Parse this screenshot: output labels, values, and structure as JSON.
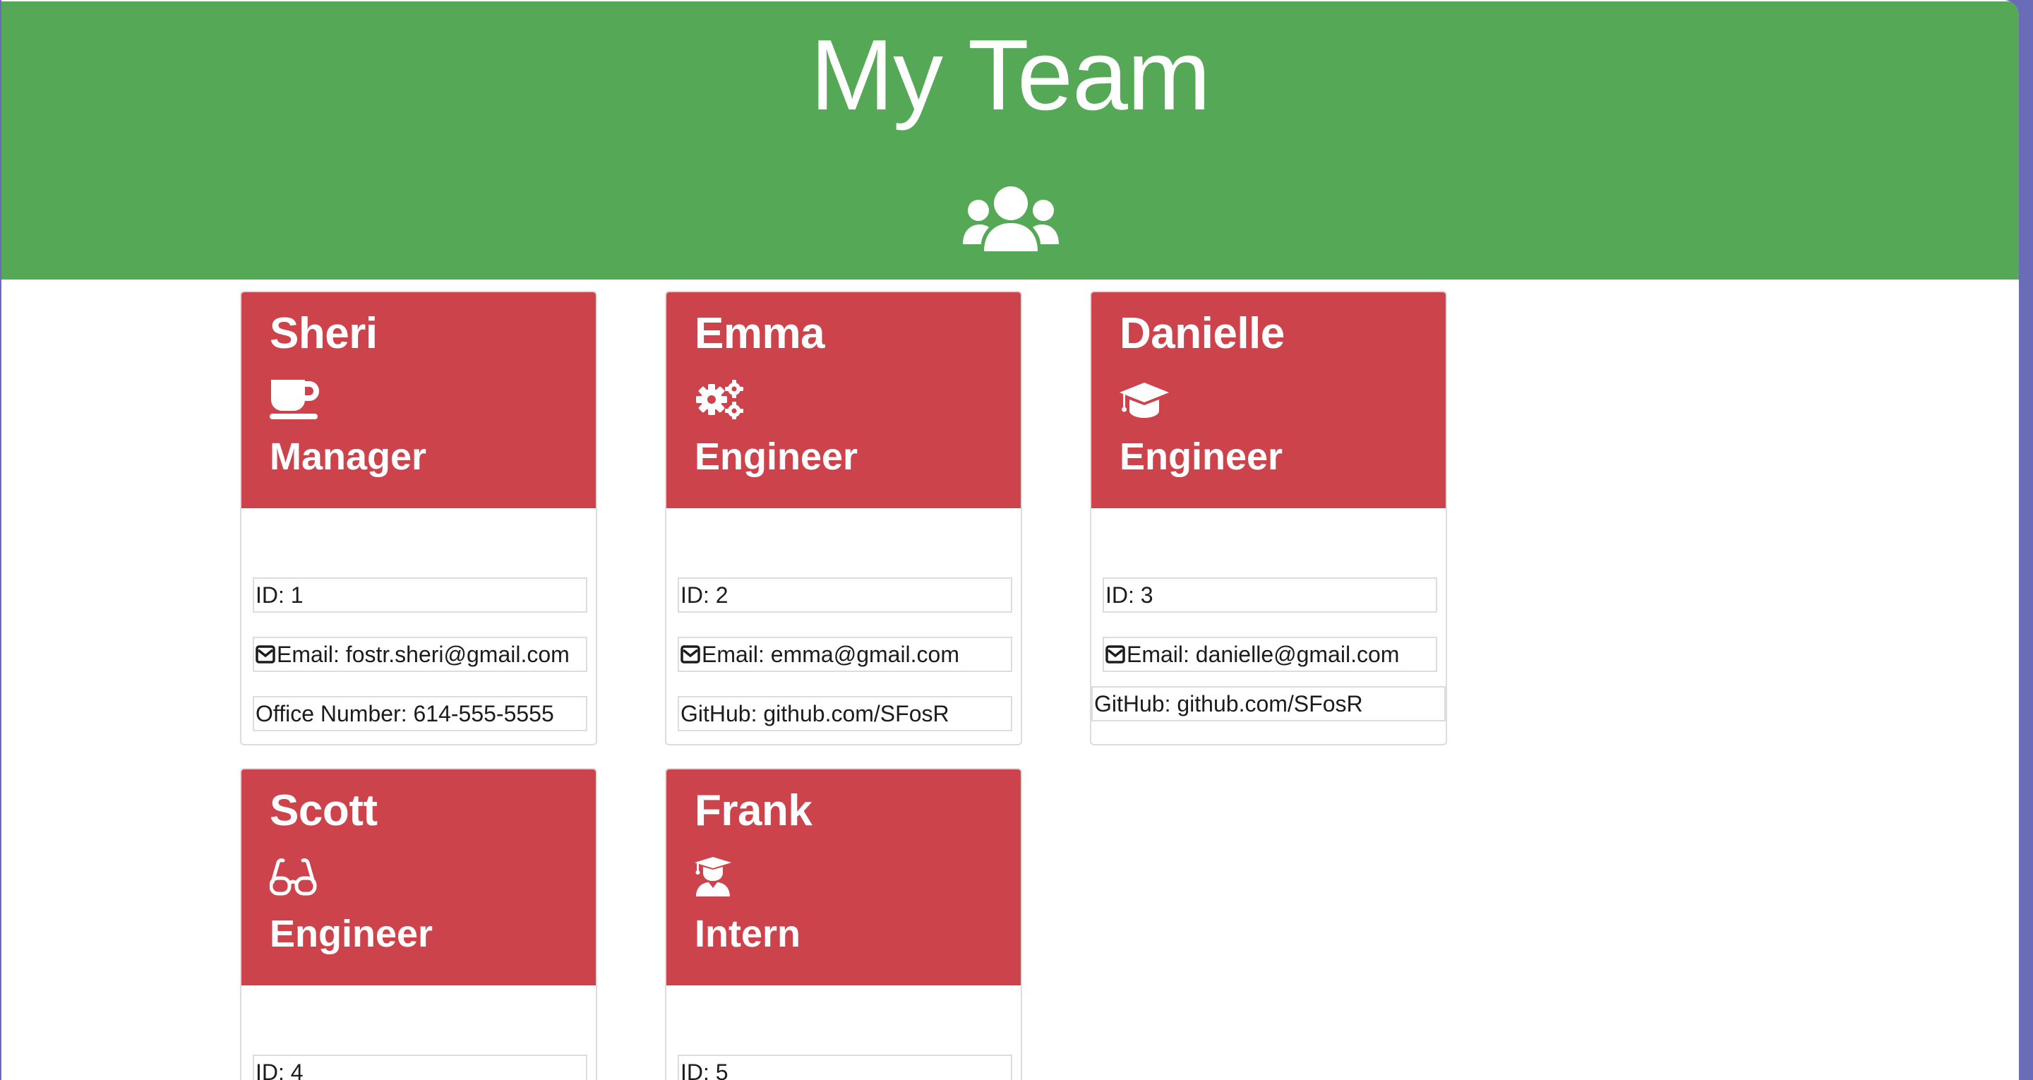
{
  "header": {
    "title": "My Team",
    "icon": "users-icon",
    "color": "#55a855"
  },
  "card_color": "#cd434b",
  "employees": [
    {
      "name": "Sheri",
      "icon": "mug-saucer-icon",
      "role": "Manager",
      "id": "ID: 1",
      "email": "Email: fostr.sheri@gmail.com",
      "extra": "Office Number: 614-555-5555"
    },
    {
      "name": "Emma",
      "icon": "gears-icon",
      "role": "Engineer",
      "id": "ID: 2",
      "email": "Email: emma@gmail.com",
      "extra": "GitHub: github.com/SFosR"
    },
    {
      "name": "Danielle",
      "icon": "graduation-cap-icon",
      "role": "Engineer",
      "id": "ID: 3",
      "email": "Email: danielle@gmail.com",
      "extra": "GitHub: github.com/SFosR"
    },
    {
      "name": "Scott",
      "icon": "glasses-icon",
      "role": "Engineer",
      "id": "ID: 4",
      "email": "",
      "extra": ""
    },
    {
      "name": "Frank",
      "icon": "user-graduate-icon",
      "role": "Intern",
      "id": "ID: 5",
      "email": "",
      "extra": ""
    }
  ]
}
